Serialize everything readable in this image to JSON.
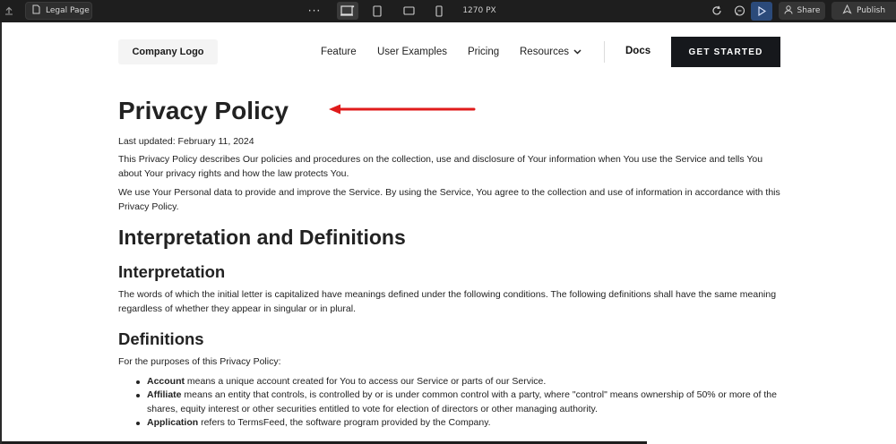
{
  "toolbar": {
    "page_tab_label": "Legal Page",
    "canvas_width_label": "1270 PX",
    "share_label": "Share",
    "publish_label": "Publish"
  },
  "header": {
    "logo": "Company Logo",
    "nav": [
      "Feature",
      "User Examples",
      "Pricing",
      "Resources"
    ],
    "docs": "Docs",
    "cta": "GET STARTED"
  },
  "content": {
    "title": "Privacy Policy",
    "last_updated": "Last updated: February 11, 2024",
    "intro_p1": "This Privacy Policy describes Our policies and procedures on the collection, use and disclosure of Your information when You use the Service and tells You about Your privacy rights and how the law protects You.",
    "intro_p2": "We use Your Personal data to provide and improve the Service. By using the Service, You agree to the collection and use of information in accordance with this Privacy Policy.",
    "section_title": "Interpretation and Definitions",
    "interpretation_title": "Interpretation",
    "interpretation_p": "The words of which the initial letter is capitalized have meanings defined under the following conditions. The following definitions shall have the same meaning regardless of whether they appear in singular or in plural.",
    "definitions_title": "Definitions",
    "definitions_intro": "For the purposes of this Privacy Policy:",
    "definitions": [
      {
        "term": "Account",
        "text": " means a unique account created for You to access our Service or parts of our Service."
      },
      {
        "term": "Affiliate",
        "text": " means an entity that controls, is controlled by or is under common control with a party, where \"control\" means ownership of 50% or more of the shares, equity interest or other securities entitled to vote for election of directors or other managing authority."
      },
      {
        "term": "Application",
        "text": " refers to TermsFeed, the software program provided by the Company."
      }
    ]
  },
  "colors": {
    "annotation_arrow": "#e01b1b",
    "cta_background": "#16181c",
    "preview_button": "#2b4a7a"
  }
}
